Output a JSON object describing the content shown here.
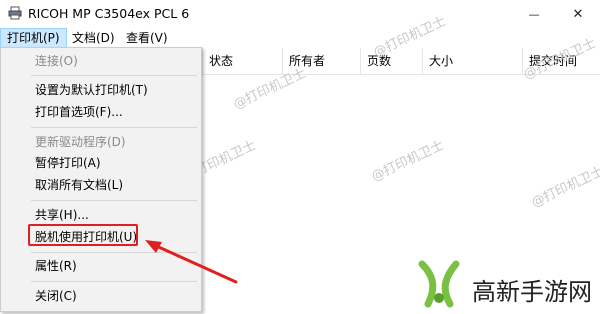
{
  "window": {
    "title": "RICOH MP C3504ex PCL 6",
    "minimize": "—",
    "close": "✕"
  },
  "menubar": {
    "items": [
      "打印机(P)",
      "文档(D)",
      "查看(V)"
    ]
  },
  "columns": [
    "状态",
    "所有者",
    "页数",
    "大小",
    "提交时间"
  ],
  "dropdown": {
    "items": [
      {
        "label": "连接(O)",
        "disabled": true
      },
      {
        "label": "设置为默认打印机(T)",
        "disabled": false
      },
      {
        "label": "打印首选项(F)...",
        "disabled": false
      },
      {
        "label": "更新驱动程序(D)",
        "disabled": true
      },
      {
        "label": "暂停打印(A)",
        "disabled": false
      },
      {
        "label": "取消所有文档(L)",
        "disabled": false
      },
      {
        "label": "共享(H)...",
        "disabled": false
      },
      {
        "label": "脱机使用打印机(U)",
        "disabled": false
      },
      {
        "label": "属性(R)",
        "disabled": false
      },
      {
        "label": "关闭(C)",
        "disabled": false
      }
    ]
  },
  "watermark": "@打印机卫士",
  "brand": {
    "name": "高新手游网",
    "accent": "#7ac143"
  },
  "annotation_color": "#e02020"
}
